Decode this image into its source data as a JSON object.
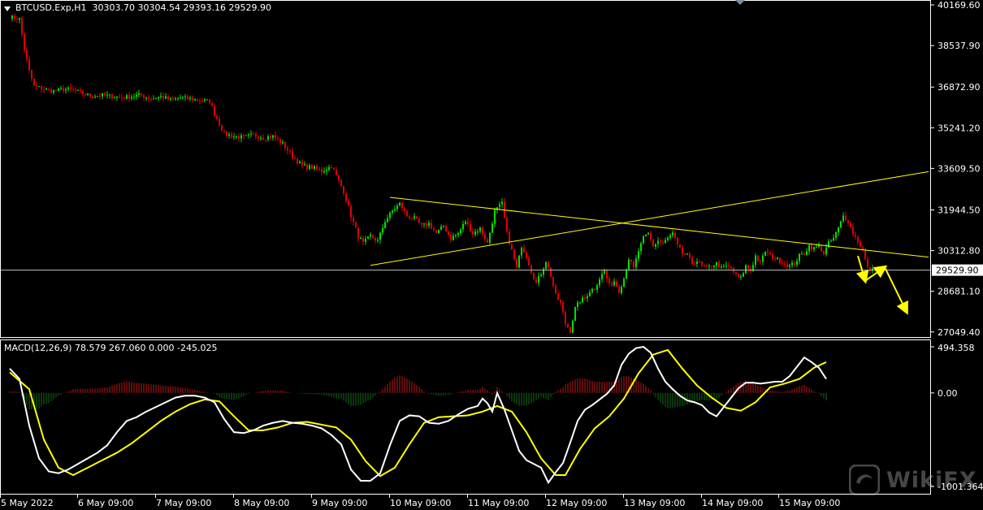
{
  "header": {
    "symbol": "BTCUSD.Exp,H1",
    "ohlc": "30303.70 30304.54 29393.16 29529.90"
  },
  "macd_header": "MACD(12,26,9) 78.579 267.060 0.000 -245.025",
  "watermark": "WikiFX",
  "colors": {
    "bg": "#000000",
    "frame": "#ffffff",
    "bull": "#00e000",
    "bear": "#e00000",
    "trendline": "#ffff00",
    "hline": "#c0c0c0",
    "macd_line": "#ffffff",
    "signal_line": "#ffff00",
    "hist_pos": "#c01818",
    "hist_neg": "#127012"
  },
  "chart_data": [
    {
      "type": "candlestick",
      "title": "BTCUSD.Exp,H1",
      "price_labels": [
        "40169.60",
        "38537.90",
        "36872.90",
        "35241.20",
        "33609.50",
        "31944.50",
        "30312.80",
        "28681.10",
        "27049.40"
      ],
      "current_price": "29529.90",
      "x_labels": [
        "5 May 2022",
        "6 May 09:00",
        "7 May 09:00",
        "8 May 09:00",
        "9 May 09:00",
        "10 May 09:00",
        "11 May 09:00",
        "12 May 09:00",
        "13 May 09:00",
        "14 May 09:00",
        "15 May 09:00"
      ],
      "ylim": [
        26700,
        40169.6
      ],
      "close_path": [
        [
          0,
          39700
        ],
        [
          4,
          39600
        ],
        [
          6,
          38400
        ],
        [
          8,
          37500
        ],
        [
          10,
          36900
        ],
        [
          14,
          36800
        ],
        [
          18,
          36700
        ],
        [
          22,
          36800
        ],
        [
          26,
          36750
        ],
        [
          30,
          36600
        ],
        [
          34,
          36500
        ],
        [
          38,
          36550
        ],
        [
          42,
          36500
        ],
        [
          46,
          36450
        ],
        [
          50,
          36500
        ],
        [
          54,
          36550
        ],
        [
          58,
          36400
        ],
        [
          62,
          36500
        ],
        [
          66,
          36350
        ],
        [
          70,
          36450
        ],
        [
          74,
          36400
        ],
        [
          78,
          36350
        ],
        [
          82,
          36300
        ],
        [
          84,
          35800
        ],
        [
          86,
          35400
        ],
        [
          88,
          35000
        ],
        [
          92,
          34900
        ],
        [
          96,
          34850
        ],
        [
          100,
          34950
        ],
        [
          104,
          34850
        ],
        [
          108,
          34900
        ],
        [
          112,
          34600
        ],
        [
          116,
          34100
        ],
        [
          120,
          33700
        ],
        [
          124,
          33650
        ],
        [
          128,
          33500
        ],
        [
          132,
          33700
        ],
        [
          134,
          33300
        ],
        [
          137,
          32700
        ],
        [
          140,
          31700
        ],
        [
          143,
          30900
        ],
        [
          145,
          30600
        ],
        [
          148,
          30900
        ],
        [
          151,
          30700
        ],
        [
          154,
          31500
        ],
        [
          157,
          31900
        ],
        [
          160,
          32200
        ],
        [
          163,
          31700
        ],
        [
          166,
          31600
        ],
        [
          169,
          31300
        ],
        [
          172,
          31400
        ],
        [
          175,
          31000
        ],
        [
          178,
          31300
        ],
        [
          181,
          30800
        ],
        [
          184,
          31000
        ],
        [
          187,
          31500
        ],
        [
          190,
          31000
        ],
        [
          193,
          31200
        ],
        [
          196,
          30600
        ],
        [
          199,
          31900
        ],
        [
          202,
          32200
        ],
        [
          204,
          31000
        ],
        [
          206,
          30300
        ],
        [
          208,
          29600
        ],
        [
          210,
          30500
        ],
        [
          212,
          30100
        ],
        [
          214,
          29500
        ],
        [
          216,
          29000
        ],
        [
          218,
          29400
        ],
        [
          220,
          29900
        ],
        [
          222,
          29300
        ],
        [
          224,
          28500
        ],
        [
          226,
          28200
        ],
        [
          228,
          27400
        ],
        [
          230,
          27100
        ],
        [
          232,
          28000
        ],
        [
          234,
          28300
        ],
        [
          236,
          28400
        ],
        [
          238,
          28700
        ],
        [
          240,
          28800
        ],
        [
          242,
          29200
        ],
        [
          244,
          29500
        ],
        [
          246,
          28900
        ],
        [
          248,
          29100
        ],
        [
          250,
          28700
        ],
        [
          252,
          29200
        ],
        [
          254,
          30000
        ],
        [
          256,
          29600
        ],
        [
          258,
          30300
        ],
        [
          260,
          30800
        ],
        [
          262,
          31000
        ],
        [
          264,
          30500
        ],
        [
          266,
          30700
        ],
        [
          268,
          30600
        ],
        [
          270,
          30800
        ],
        [
          272,
          31000
        ],
        [
          274,
          30500
        ],
        [
          276,
          30200
        ],
        [
          278,
          30100
        ],
        [
          280,
          29800
        ],
        [
          282,
          29900
        ],
        [
          284,
          29700
        ],
        [
          286,
          29600
        ],
        [
          288,
          29700
        ],
        [
          290,
          29800
        ],
        [
          292,
          29600
        ],
        [
          294,
          29700
        ],
        [
          296,
          29600
        ],
        [
          298,
          29300
        ],
        [
          300,
          29200
        ],
        [
          302,
          29700
        ],
        [
          304,
          29500
        ],
        [
          306,
          30100
        ],
        [
          308,
          29800
        ],
        [
          310,
          30300
        ],
        [
          312,
          30100
        ],
        [
          314,
          30000
        ],
        [
          316,
          29900
        ],
        [
          318,
          29800
        ],
        [
          320,
          29700
        ],
        [
          322,
          29800
        ],
        [
          324,
          30100
        ],
        [
          326,
          30200
        ],
        [
          328,
          30500
        ],
        [
          330,
          30400
        ],
        [
          332,
          30500
        ],
        [
          334,
          30200
        ],
        [
          336,
          30600
        ],
        [
          338,
          30800
        ],
        [
          340,
          31200
        ],
        [
          342,
          31700
        ],
        [
          344,
          31500
        ],
        [
          346,
          31000
        ],
        [
          348,
          30700
        ],
        [
          350,
          30300
        ],
        [
          352,
          29600
        ],
        [
          354,
          29530
        ]
      ],
      "trendlines": [
        {
          "from": [
            156,
            32450
          ],
          "to": [
            377,
            30050
          ]
        },
        {
          "from": [
            148,
            29720
          ],
          "to": [
            377,
            33480
          ]
        }
      ],
      "forecast_arrows": [
        {
          "from": [
            348,
            30100
          ],
          "to": [
            351,
            29100
          ]
        },
        {
          "from": [
            351,
            29100
          ],
          "to": [
            359,
            29650
          ]
        },
        {
          "from": [
            359,
            29650
          ],
          "to": [
            368,
            27850
          ]
        }
      ]
    },
    {
      "type": "macd",
      "title": "MACD(12,26,9) 78.579 267.060 0.000 -245.025",
      "y_labels": [
        "494.358",
        "0.00",
        "-1001.364"
      ],
      "ylim": [
        -1001.364,
        494.358
      ],
      "macd": [
        [
          0,
          260
        ],
        [
          4,
          150
        ],
        [
          8,
          -350
        ],
        [
          12,
          -700
        ],
        [
          16,
          -840
        ],
        [
          20,
          -860
        ],
        [
          24,
          -820
        ],
        [
          28,
          -760
        ],
        [
          32,
          -700
        ],
        [
          36,
          -640
        ],
        [
          40,
          -560
        ],
        [
          44,
          -420
        ],
        [
          48,
          -300
        ],
        [
          52,
          -260
        ],
        [
          56,
          -200
        ],
        [
          60,
          -150
        ],
        [
          64,
          -100
        ],
        [
          68,
          -50
        ],
        [
          72,
          -30
        ],
        [
          76,
          -30
        ],
        [
          80,
          -50
        ],
        [
          84,
          -100
        ],
        [
          88,
          -280
        ],
        [
          92,
          -420
        ],
        [
          96,
          -430
        ],
        [
          100,
          -400
        ],
        [
          104,
          -350
        ],
        [
          108,
          -320
        ],
        [
          112,
          -300
        ],
        [
          116,
          -320
        ],
        [
          120,
          -330
        ],
        [
          124,
          -350
        ],
        [
          128,
          -380
        ],
        [
          132,
          -450
        ],
        [
          136,
          -550
        ],
        [
          140,
          -820
        ],
        [
          144,
          -940
        ],
        [
          148,
          -940
        ],
        [
          152,
          -860
        ],
        [
          156,
          -560
        ],
        [
          160,
          -300
        ],
        [
          164,
          -240
        ],
        [
          168,
          -250
        ],
        [
          172,
          -320
        ],
        [
          176,
          -330
        ],
        [
          180,
          -300
        ],
        [
          184,
          -230
        ],
        [
          188,
          -170
        ],
        [
          192,
          -140
        ],
        [
          194,
          -60
        ],
        [
          196,
          -110
        ],
        [
          198,
          -200
        ],
        [
          200,
          0
        ],
        [
          203,
          -180
        ],
        [
          206,
          -400
        ],
        [
          209,
          -620
        ],
        [
          212,
          -720
        ],
        [
          215,
          -760
        ],
        [
          218,
          -800
        ],
        [
          221,
          -960
        ],
        [
          224,
          -850
        ],
        [
          227,
          -750
        ],
        [
          230,
          -530
        ],
        [
          233,
          -300
        ],
        [
          236,
          -180
        ],
        [
          239,
          -130
        ],
        [
          242,
          -70
        ],
        [
          245,
          -10
        ],
        [
          248,
          80
        ],
        [
          251,
          300
        ],
        [
          254,
          420
        ],
        [
          257,
          480
        ],
        [
          260,
          494
        ],
        [
          263,
          430
        ],
        [
          266,
          260
        ],
        [
          269,
          120
        ],
        [
          272,
          40
        ],
        [
          275,
          -30
        ],
        [
          278,
          -80
        ],
        [
          281,
          -100
        ],
        [
          284,
          -130
        ],
        [
          287,
          -210
        ],
        [
          290,
          -250
        ],
        [
          293,
          -150
        ],
        [
          296,
          -50
        ],
        [
          299,
          50
        ],
        [
          302,
          110
        ],
        [
          305,
          110
        ],
        [
          308,
          100
        ],
        [
          311,
          110
        ],
        [
          314,
          120
        ],
        [
          317,
          120
        ],
        [
          320,
          180
        ],
        [
          323,
          280
        ],
        [
          326,
          380
        ],
        [
          329,
          330
        ],
        [
          332,
          270
        ],
        [
          335,
          150
        ]
      ],
      "signal": [
        [
          0,
          220
        ],
        [
          8,
          40
        ],
        [
          14,
          -500
        ],
        [
          20,
          -800
        ],
        [
          26,
          -880
        ],
        [
          32,
          -800
        ],
        [
          38,
          -720
        ],
        [
          44,
          -640
        ],
        [
          50,
          -540
        ],
        [
          56,
          -420
        ],
        [
          62,
          -300
        ],
        [
          68,
          -200
        ],
        [
          74,
          -120
        ],
        [
          80,
          -70
        ],
        [
          86,
          -90
        ],
        [
          92,
          -250
        ],
        [
          98,
          -400
        ],
        [
          104,
          -400
        ],
        [
          110,
          -370
        ],
        [
          116,
          -320
        ],
        [
          122,
          -310
        ],
        [
          128,
          -340
        ],
        [
          134,
          -370
        ],
        [
          140,
          -500
        ],
        [
          146,
          -730
        ],
        [
          152,
          -890
        ],
        [
          158,
          -800
        ],
        [
          164,
          -550
        ],
        [
          170,
          -320
        ],
        [
          176,
          -260
        ],
        [
          182,
          -250
        ],
        [
          188,
          -240
        ],
        [
          194,
          -200
        ],
        [
          200,
          -140
        ],
        [
          206,
          -200
        ],
        [
          212,
          -420
        ],
        [
          218,
          -700
        ],
        [
          224,
          -880
        ],
        [
          228,
          -880
        ],
        [
          234,
          -600
        ],
        [
          240,
          -380
        ],
        [
          246,
          -250
        ],
        [
          252,
          -60
        ],
        [
          258,
          210
        ],
        [
          264,
          410
        ],
        [
          270,
          460
        ],
        [
          276,
          260
        ],
        [
          282,
          80
        ],
        [
          288,
          -50
        ],
        [
          294,
          -160
        ],
        [
          300,
          -190
        ],
        [
          306,
          -100
        ],
        [
          312,
          60
        ],
        [
          318,
          100
        ],
        [
          324,
          150
        ],
        [
          330,
          270
        ],
        [
          335,
          330
        ]
      ],
      "histogram_note": "bars per bar index (positive red, negative green)"
    }
  ]
}
